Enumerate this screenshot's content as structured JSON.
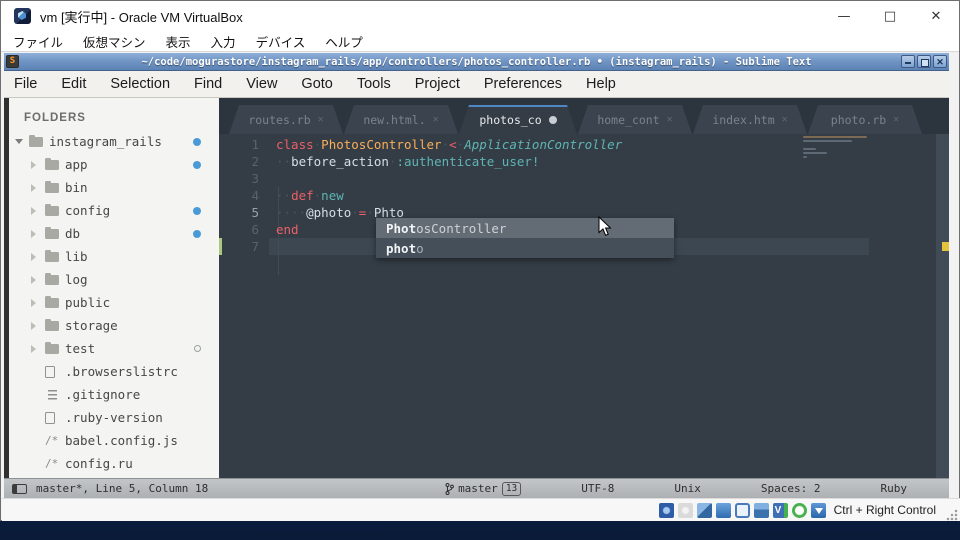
{
  "host": {
    "title": "vm [実行中] - Oracle VM VirtualBox",
    "window_controls": {
      "minimize": "—",
      "maximize": "□",
      "close": "✕"
    },
    "menu": [
      "ファイル",
      "仮想マシン",
      "表示",
      "入力",
      "デバイス",
      "ヘルプ"
    ],
    "statusbar": {
      "icons": [
        "hard-disks",
        "optical-drives",
        "network",
        "usb",
        "display",
        "shared-folders",
        "features",
        "mouse-integration",
        "keyboard"
      ],
      "features_glyph": "V",
      "shortcut": "Ctrl + Right Control"
    }
  },
  "sublime": {
    "logo_glyph": "S",
    "title": "~/code/mogurastore/instagram_rails/app/controllers/photos_controller.rb • (instagram_rails) - Sublime Text",
    "menu": [
      "File",
      "Edit",
      "Selection",
      "Find",
      "View",
      "Goto",
      "Tools",
      "Project",
      "Preferences",
      "Help"
    ],
    "sidebar": {
      "header": "FOLDERS",
      "items": [
        {
          "label": "instagram_rails",
          "type": "folder",
          "level": 0,
          "expanded": true,
          "badge": "dot"
        },
        {
          "label": "app",
          "type": "folder",
          "level": 1,
          "expanded": false,
          "badge": "dot"
        },
        {
          "label": "bin",
          "type": "folder",
          "level": 1,
          "expanded": false,
          "badge": ""
        },
        {
          "label": "config",
          "type": "folder",
          "level": 1,
          "expanded": false,
          "badge": "dot"
        },
        {
          "label": "db",
          "type": "folder",
          "level": 1,
          "expanded": false,
          "badge": "dot"
        },
        {
          "label": "lib",
          "type": "folder",
          "level": 1,
          "expanded": false,
          "badge": ""
        },
        {
          "label": "log",
          "type": "folder",
          "level": 1,
          "expanded": false,
          "badge": ""
        },
        {
          "label": "public",
          "type": "folder",
          "level": 1,
          "expanded": false,
          "badge": ""
        },
        {
          "label": "storage",
          "type": "folder",
          "level": 1,
          "expanded": false,
          "badge": ""
        },
        {
          "label": "test",
          "type": "folder",
          "level": 1,
          "expanded": false,
          "badge": "circle"
        },
        {
          "label": ".browserslistrc",
          "type": "file",
          "level": 1,
          "badge": ""
        },
        {
          "label": ".gitignore",
          "type": "list",
          "level": 1,
          "badge": ""
        },
        {
          "label": ".ruby-version",
          "type": "file",
          "level": 1,
          "badge": ""
        },
        {
          "label": "babel.config.js",
          "type": "text",
          "icon_text": "/*",
          "level": 1,
          "badge": ""
        },
        {
          "label": "config.ru",
          "type": "text",
          "icon_text": "/*",
          "level": 1,
          "badge": ""
        }
      ]
    },
    "tabs": [
      {
        "label": "routes.rb",
        "close": "✕",
        "active": false,
        "modified": false
      },
      {
        "label": "new.html.",
        "close": "✕",
        "active": false,
        "modified": false
      },
      {
        "label": "photos_co",
        "close": "",
        "active": true,
        "modified": true
      },
      {
        "label": "home_cont",
        "close": "✕",
        "active": false,
        "modified": false
      },
      {
        "label": "index.htm",
        "close": "✕",
        "active": false,
        "modified": false
      },
      {
        "label": "photo.rb",
        "close": "✕",
        "active": false,
        "modified": false
      }
    ],
    "editor": {
      "lines": [
        {
          "num": "1",
          "active": false,
          "tokens": [
            [
              "kw",
              "class"
            ],
            [
              "ws",
              "·"
            ],
            [
              "cls",
              "PhotosController"
            ],
            [
              "ws",
              "·"
            ],
            [
              "kw",
              "<"
            ],
            [
              "ws",
              "·"
            ],
            [
              "inh",
              "ApplicationController"
            ]
          ]
        },
        {
          "num": "2",
          "active": false,
          "tokens": [
            [
              "ws",
              "··"
            ],
            [
              "txt",
              "before_action"
            ],
            [
              "ws",
              "·"
            ],
            [
              "sym",
              ":authenticate_user!"
            ]
          ]
        },
        {
          "num": "3",
          "active": false,
          "tokens": []
        },
        {
          "num": "4",
          "active": false,
          "tokens": [
            [
              "ws",
              "··"
            ],
            [
              "kw",
              "def"
            ],
            [
              "ws",
              "·"
            ],
            [
              "fn",
              "new"
            ]
          ]
        },
        {
          "num": "5",
          "active": true,
          "tokens": [
            [
              "ws",
              "····"
            ],
            [
              "txt",
              "@photo"
            ],
            [
              "ws",
              "·"
            ],
            [
              "kw",
              "="
            ],
            [
              "ws",
              "·"
            ],
            [
              "txt",
              "Phto"
            ]
          ]
        },
        {
          "num": "6",
          "active": false,
          "tokens": [
            [
              "kw",
              "end"
            ]
          ]
        },
        {
          "num": "7",
          "active": false,
          "tokens": []
        }
      ]
    },
    "autocomplete": [
      {
        "match": "Phot",
        "rest": "osController",
        "selected": true
      },
      {
        "match": "phot",
        "rest": "o",
        "selected": false
      }
    ],
    "statusbar": {
      "left": "master*, Line 5, Column 18",
      "branch": "master",
      "branch_count": "13",
      "encoding": "UTF-8",
      "line_endings": "Unix",
      "indent": "Spaces: 2",
      "syntax": "Ruby"
    }
  },
  "colors": {
    "accent_tab": "#4f86c5",
    "editor_bg": "#343d46",
    "keyword": "#ec5f66",
    "class_name": "#f9ae58",
    "teal": "#5fb4b4",
    "modified_gutter": "#a9c97e",
    "scroll_marker": "#e3c43c",
    "sidebar_dot": "#4b9ad8"
  }
}
